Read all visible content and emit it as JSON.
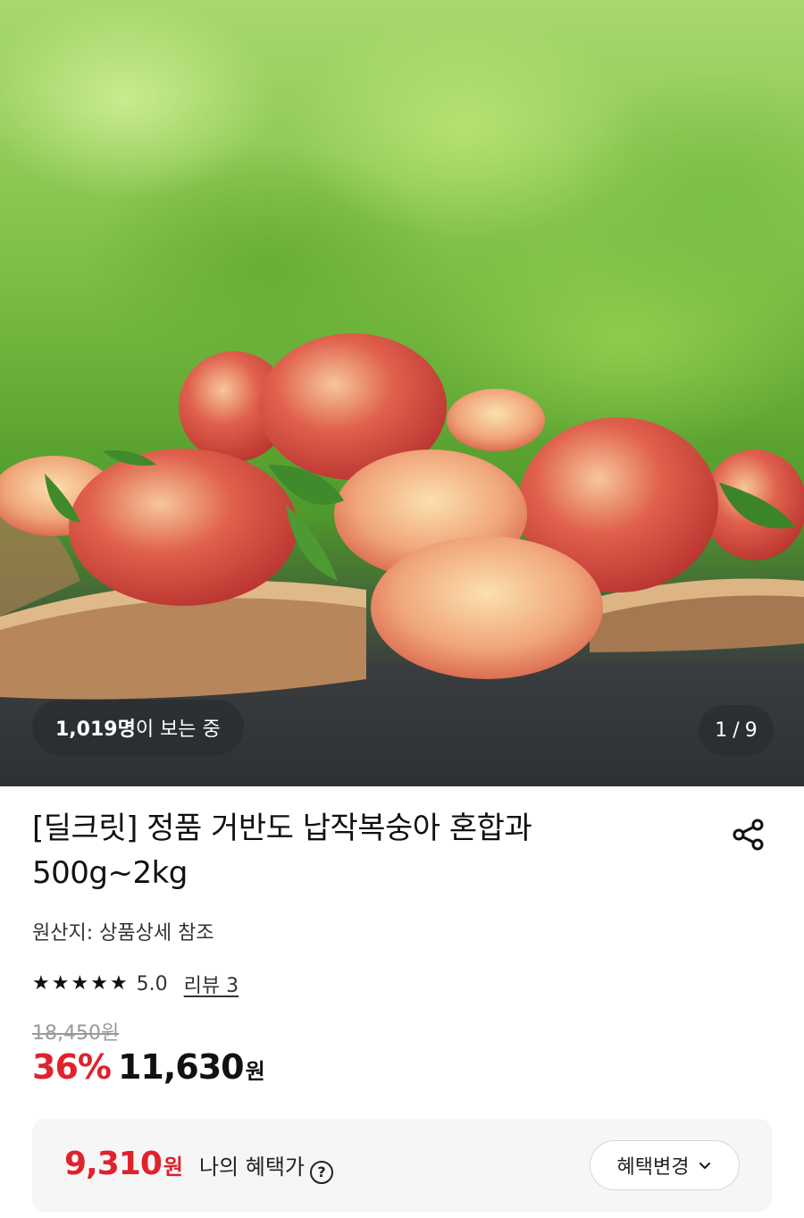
{
  "hero": {
    "viewers_count": "1,019명",
    "viewers_suffix": "이 보는 중",
    "image_index": "1",
    "image_separator": "/",
    "image_total": "9"
  },
  "product": {
    "title_line1": "[딜크릿] 정품 거반도 납작복숭아 혼합과",
    "title_line2": "500g~2kg",
    "origin": "원산지: 상품상세 참조",
    "rating_value": 5,
    "rating_text": "5.0",
    "review_link": "리뷰 3",
    "original_price": "18,450원",
    "discount": "36%",
    "sale_price": "11,630",
    "currency": "원"
  },
  "benefit": {
    "amount": "9,310",
    "currency": "원",
    "label": "나의 혜택가",
    "help_glyph": "?",
    "change_button": "혜택변경"
  },
  "icons": {
    "share": "share-icon",
    "help": "help-circle-icon",
    "chevron": "chevron-down-icon",
    "star": "star-icon"
  },
  "colors": {
    "accent_red": "#e0222c",
    "pill_bg": "#282c30",
    "benefit_bg": "#f6f6f7"
  }
}
